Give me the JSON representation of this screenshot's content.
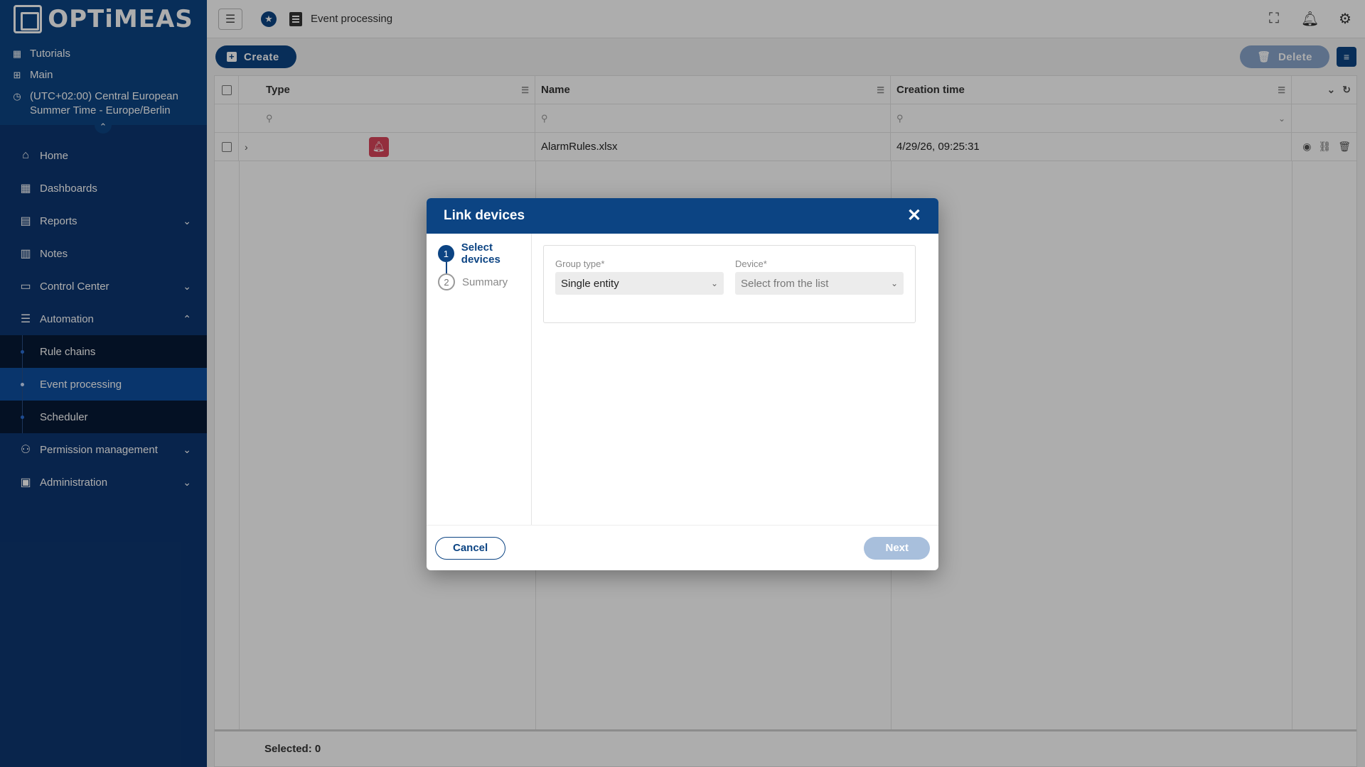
{
  "brand": {
    "logo_text": "OPTiMEAS"
  },
  "sidebar": {
    "meta": [
      {
        "icon": "tutorials-icon",
        "label": "Tutorials"
      },
      {
        "icon": "tree-icon",
        "label": "Main"
      },
      {
        "icon": "clock-icon",
        "label": "(UTC+02:00) Central European Summer Time - Europe/Berlin"
      }
    ],
    "items": [
      {
        "icon": "home-icon",
        "label": "Home"
      },
      {
        "icon": "dashboard-icon",
        "label": "Dashboards"
      },
      {
        "icon": "clipboard-icon",
        "label": "Reports"
      },
      {
        "icon": "note-icon",
        "label": "Notes"
      },
      {
        "icon": "devices-icon",
        "label": "Control Center"
      },
      {
        "icon": "sliders-icon",
        "label": "Automation"
      },
      {
        "icon": "people-icon",
        "label": "Permission management"
      },
      {
        "icon": "admin-icon",
        "label": "Administration"
      }
    ],
    "automation_sub": [
      {
        "label": "Rule chains"
      },
      {
        "label": "Event processing"
      },
      {
        "label": "Scheduler"
      }
    ]
  },
  "topbar": {
    "page_title": "Event processing"
  },
  "toolbar": {
    "create_label": "Create",
    "delete_label": "Delete"
  },
  "table": {
    "columns": [
      "Type",
      "Name",
      "Creation time"
    ],
    "rows": [
      {
        "type_icon": "alarm-bell-icon",
        "name": "AlarmRules.xlsx",
        "created": "4/29/26, 09:25:31"
      }
    ],
    "footer": "Selected: 0"
  },
  "dialog": {
    "title": "Link devices",
    "steps": [
      {
        "num": "1",
        "label": "Select devices",
        "state": "active"
      },
      {
        "num": "2",
        "label": "Summary",
        "state": "inactive"
      }
    ],
    "group_type": {
      "label": "Group type*",
      "value": "Single entity"
    },
    "device": {
      "label": "Device*",
      "placeholder": "Select from the list"
    },
    "cancel_label": "Cancel",
    "next_label": "Next"
  },
  "colors": {
    "primary": "#0c4483",
    "alarm": "#d9455a",
    "disabled": "#a8bfdc"
  }
}
